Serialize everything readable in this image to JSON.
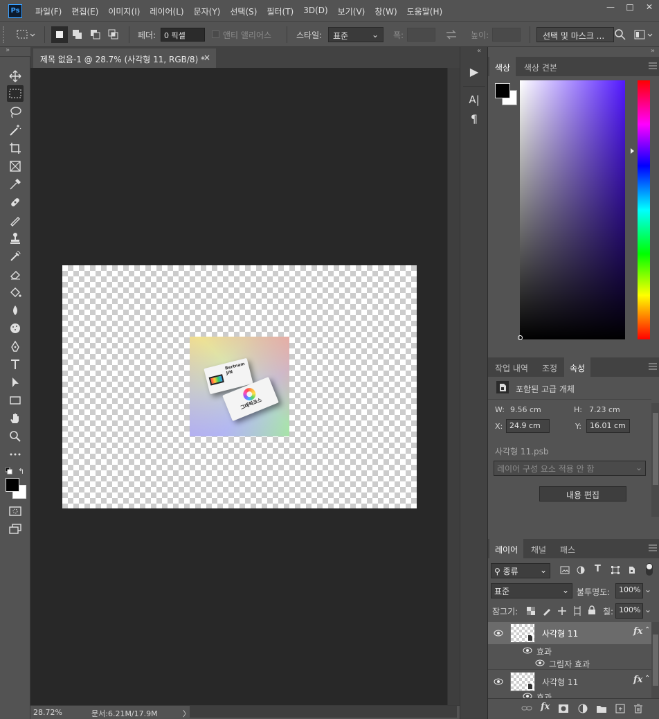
{
  "app": {
    "logo": "Ps",
    "menu": [
      "파일(F)",
      "편집(E)",
      "이미지(I)",
      "레이어(L)",
      "문자(Y)",
      "선택(S)",
      "필터(T)",
      "3D(D)",
      "보기(V)",
      "창(W)",
      "도움말(H)"
    ],
    "window_controls": [
      "—",
      "□",
      "✕"
    ]
  },
  "options": {
    "feather_label": "페더:",
    "feather_value": "0 픽셀",
    "antialias_label": "앤티 앨리어스",
    "style_label": "스타일:",
    "style_value": "표준",
    "width_label": "폭:",
    "height_label": "높이:",
    "select_mask_button": "선택 및 마스크 ..."
  },
  "document": {
    "tab_title": "제목 없음-1 @ 28.7% (사각형 11, RGB/8) *",
    "close": "×",
    "card_name": "Bertnam JIN",
    "card_brand": "그래픽코스",
    "zoom": "28.72%",
    "doc_info": "문서:6.21M/17.9M",
    "status_arrow": "〉"
  },
  "color_panel": {
    "tabs": [
      "색상",
      "색상 견본"
    ],
    "foreground": "#000000",
    "background": "#ffffff"
  },
  "properties_panel": {
    "tabs": [
      "작업 내역",
      "조정",
      "속성"
    ],
    "type_label": "포함된 고급 개체",
    "w_label": "W:",
    "w_value": "9.56 cm",
    "h_label": "H:",
    "h_value": "7.23 cm",
    "x_label": "X:",
    "x_value": "24.9 cm",
    "y_label": "Y:",
    "y_value": "16.01 cm",
    "file_name": "사각형 11.psb",
    "comp_select": "레이어 구성 요소 적용 안 함",
    "edit_contents_button": "내용 편집"
  },
  "layers_panel": {
    "tabs": [
      "레이어",
      "채널",
      "패스"
    ],
    "filter_kind": "종류",
    "blend_mode": "표준",
    "opacity_label": "불투명도:",
    "opacity_value": "100%",
    "lock_label": "잠그기:",
    "fill_label": "칠:",
    "fill_value": "100%",
    "layers": [
      {
        "name": "사각형 11",
        "fx": "fx",
        "effects_label": "효과",
        "effect": "그림자 효과"
      },
      {
        "name": "사각형 11",
        "fx": "fx",
        "effects_label": "효과"
      }
    ],
    "footer_fx": "fx"
  },
  "mid_panel": {
    "play": "▶",
    "char": "A|",
    "para": "¶"
  },
  "collapse": "«",
  "expand": "»"
}
